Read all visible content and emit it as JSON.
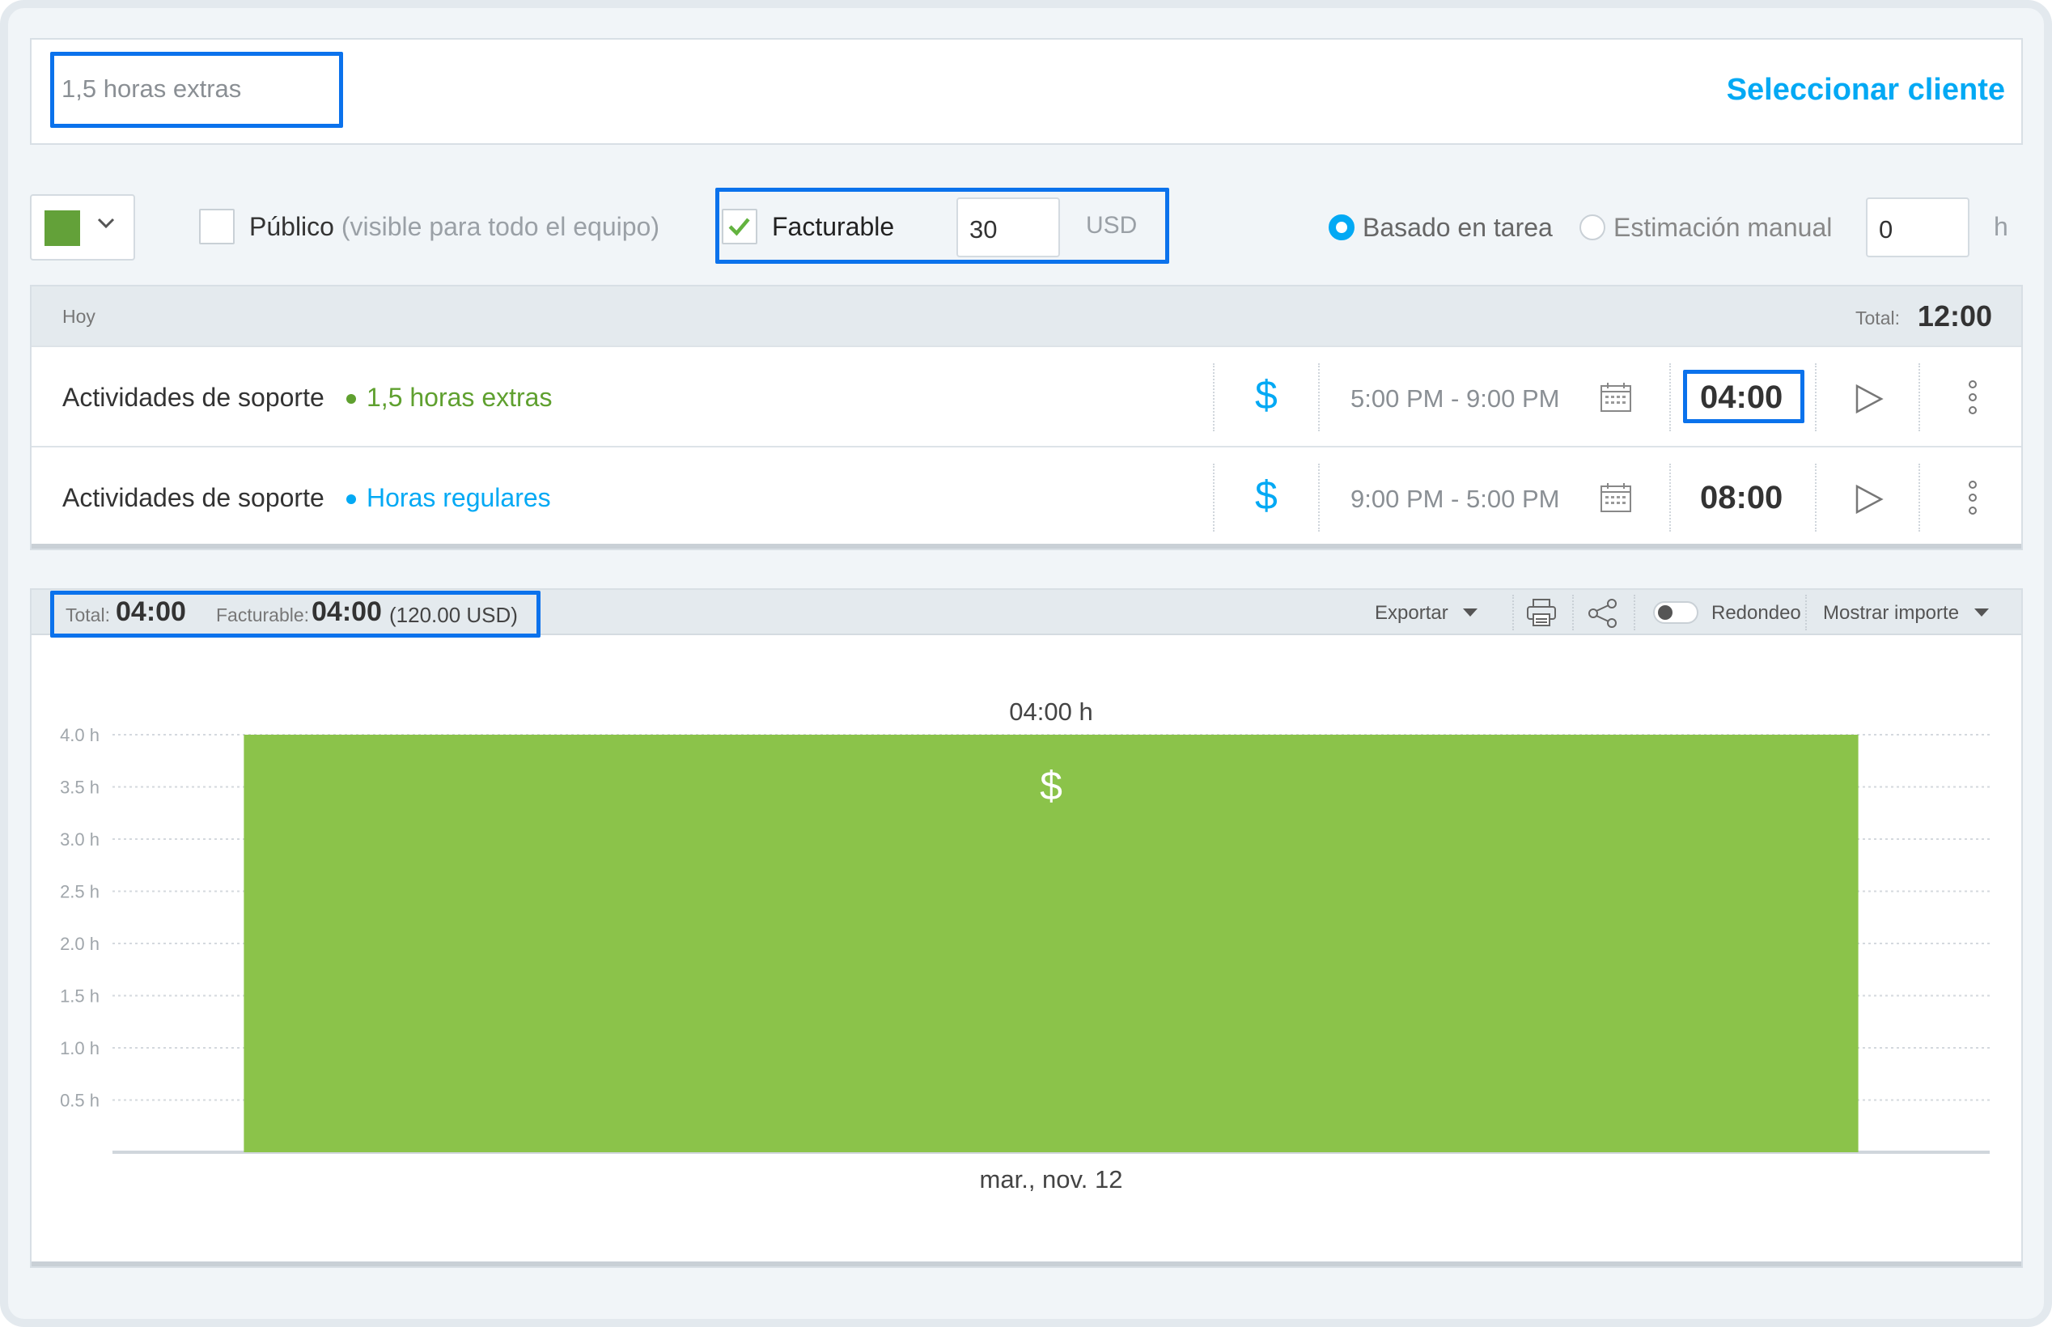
{
  "project": {
    "name_input": "1,5 horas extras",
    "select_client": "Seleccionar cliente"
  },
  "settings": {
    "public_label": "Público",
    "public_hint": "(visible para todo el equipo)",
    "billable_label": "Facturable",
    "billable_checked": true,
    "rate": "30",
    "currency": "USD",
    "estimate_task": "Basado en tarea",
    "estimate_manual": "Estimación manual",
    "estimate_selected": "Basado en tarea",
    "estimate_value": "0",
    "estimate_unit": "h",
    "color": "#63a139"
  },
  "entries": {
    "header_label": "Hoy",
    "total_label": "Total:",
    "total_value": "12:00",
    "rows": [
      {
        "description": "Actividades de soporte",
        "tag": "1,5 horas extras",
        "tag_color": "#5fa02f",
        "billable_icon": "$",
        "time_range": "5:00 PM - 9:00 PM",
        "duration": "04:00"
      },
      {
        "description": "Actividades de soporte",
        "tag": "Horas regulares",
        "tag_color": "#03a9f4",
        "billable_icon": "$",
        "time_range": "9:00 PM - 5:00 PM",
        "duration": "08:00"
      }
    ]
  },
  "report": {
    "total_label": "Total:",
    "total_value": "04:00",
    "billable_label": "Facturable:",
    "billable_value": "04:00",
    "billable_amount": "(120.00 USD)",
    "export_label": "Exportar",
    "rounding_label": "Redondeo",
    "show_amount_label": "Mostrar importe"
  },
  "chart_data": {
    "type": "bar",
    "categories": [
      "mar., nov. 12"
    ],
    "values": [
      4.0
    ],
    "bar_label": "04:00 h",
    "bar_icon": "$",
    "bar_color": "#8bc34a",
    "yticks": [
      "0.5 h",
      "1.0 h",
      "1.5 h",
      "2.0 h",
      "2.5 h",
      "3.0 h",
      "3.5 h",
      "4.0 h"
    ],
    "ylim": [
      0,
      4.0
    ],
    "grid": true
  }
}
